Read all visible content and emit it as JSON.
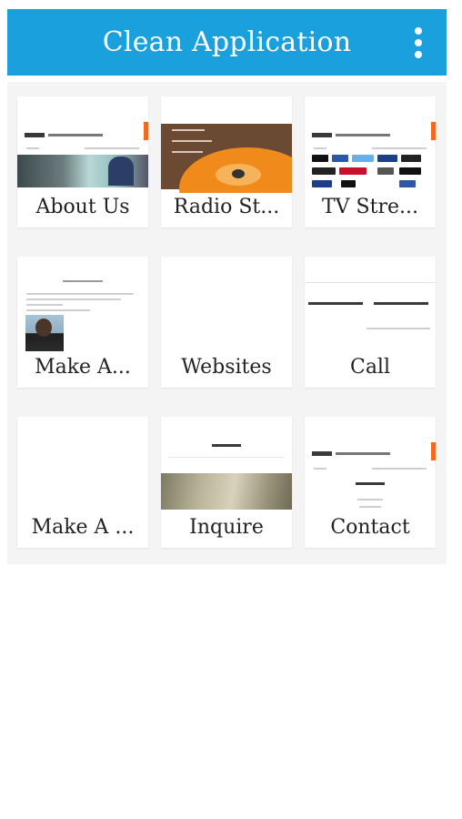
{
  "appbar": {
    "title": "Clean Application",
    "menu_icon": "overflow-menu-icon"
  },
  "colors": {
    "appbar": "#1aa0dc",
    "panel": "#f4f4f4",
    "tile": "#ffffff",
    "accent_orange": "#f26b1d"
  },
  "tiles": [
    {
      "label": "About Us"
    },
    {
      "label": "Radio St..."
    },
    {
      "label": "TV Stre..."
    },
    {
      "label": "Make A..."
    },
    {
      "label": "Websites"
    },
    {
      "label": "Call"
    },
    {
      "label": "Make A ..."
    },
    {
      "label": "Inquire"
    },
    {
      "label": "Contact"
    }
  ]
}
